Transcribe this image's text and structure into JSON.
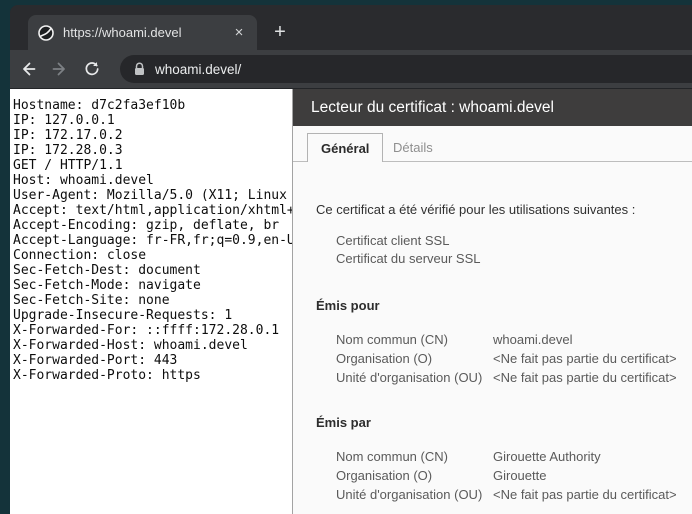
{
  "browser": {
    "tab": {
      "title": "https://whoami.devel",
      "close_glyph": "×",
      "new_tab_glyph": "+"
    },
    "toolbar": {
      "url": "whoami.devel/"
    }
  },
  "page": {
    "lines": [
      "Hostname: d7c2fa3ef10b",
      "IP: 127.0.0.1",
      "IP: 172.17.0.2",
      "IP: 172.28.0.3",
      "GET / HTTP/1.1",
      "Host: whoami.devel",
      "User-Agent: Mozilla/5.0 (X11; Linux",
      "Accept: text/html,application/xhtml+",
      "Accept-Encoding: gzip, deflate, br",
      "Accept-Language: fr-FR,fr;q=0.9,en-U",
      "Connection: close",
      "Sec-Fetch-Dest: document",
      "Sec-Fetch-Mode: navigate",
      "Sec-Fetch-Site: none",
      "Upgrade-Insecure-Requests: 1",
      "X-Forwarded-For: ::ffff:172.28.0.1",
      "X-Forwarded-Host: whoami.devel",
      "X-Forwarded-Port: 443",
      "X-Forwarded-Proto: https"
    ]
  },
  "dialog": {
    "title": "Lecteur du certificat : whoami.devel",
    "tabs": [
      {
        "label": "Général"
      },
      {
        "label": "Détails"
      }
    ],
    "verified_heading": "Ce certificat a été vérifié pour les utilisations suivantes :",
    "usages": [
      "Certificat client SSL",
      "Certificat du serveur SSL"
    ],
    "issued_to": {
      "heading": "Émis pour",
      "rows": [
        {
          "label": "Nom commun (CN)",
          "value": "whoami.devel"
        },
        {
          "label": "Organisation (O)",
          "value": "<Ne fait pas partie du certificat>"
        },
        {
          "label": "Unité d'organisation (OU)",
          "value": "<Ne fait pas partie du certificat>"
        }
      ]
    },
    "issued_by": {
      "heading": "Émis par",
      "rows": [
        {
          "label": "Nom commun (CN)",
          "value": "Girouette Authority"
        },
        {
          "label": "Organisation (O)",
          "value": "Girouette"
        },
        {
          "label": "Unité d'organisation (OU)",
          "value": "<Ne fait pas partie du certificat>"
        }
      ]
    }
  },
  "colors": {
    "frame": "#14333a",
    "tabbar_bg": "#2a2b2e",
    "toolbar_bg": "#3c3e41",
    "urlbar_bg": "#26272a",
    "dialog_header_bg": "#3e3d3d",
    "dialog_bg": "#fafafa"
  }
}
